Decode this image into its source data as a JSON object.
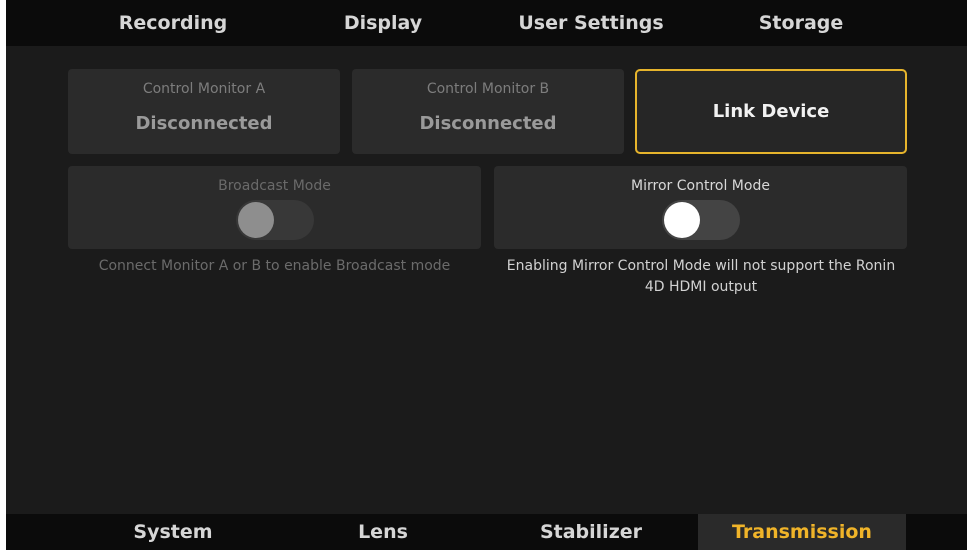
{
  "top_tabs": [
    "Recording",
    "Display",
    "User Settings",
    "Storage"
  ],
  "monitors": [
    {
      "label": "Control Monitor A",
      "status": "Disconnected"
    },
    {
      "label": "Control Monitor B",
      "status": "Disconnected"
    }
  ],
  "link_device_label": "Link Device",
  "broadcast": {
    "label": "Broadcast Mode",
    "enabled": false,
    "hint": "Connect Monitor A or B to enable Broadcast mode"
  },
  "mirror": {
    "label": "Mirror Control Mode",
    "enabled": false,
    "hint_line1": "Enabling Mirror Control Mode will not support the Ronin",
    "hint_line2": "4D HDMI output"
  },
  "bottom_tabs": [
    "System",
    "Lens",
    "Stabilizer",
    "Transmission"
  ],
  "active_bottom_tab": "Transmission",
  "colors": {
    "accent": "#e6b42c",
    "active_tab_text": "#f0b429",
    "background": "#1b1b1b",
    "bar": "#0b0b0b"
  }
}
